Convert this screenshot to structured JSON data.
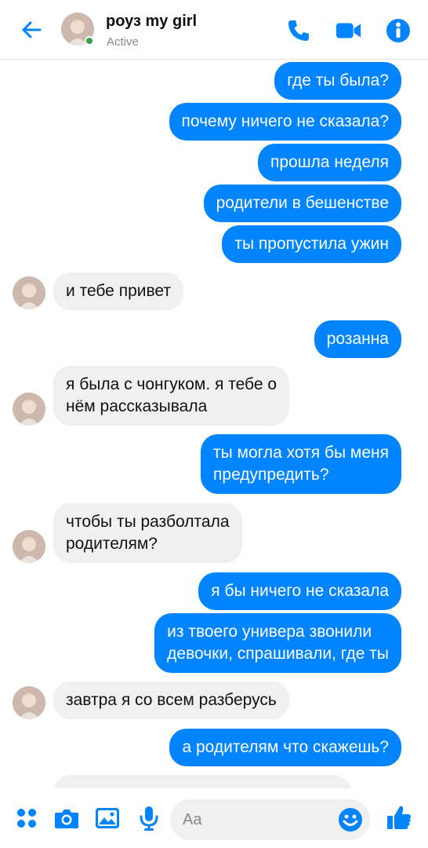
{
  "header": {
    "contact_name": "роуз my girl",
    "status": "Active"
  },
  "messages": [
    {
      "dir": "out",
      "text": "где ты была?"
    },
    {
      "dir": "out",
      "text": "почему ничего не сказала?"
    },
    {
      "dir": "out",
      "text": "прошла неделя"
    },
    {
      "dir": "out",
      "text": "родители в бешенстве"
    },
    {
      "dir": "out",
      "text": "ты пропустила ужин"
    },
    {
      "dir": "in",
      "text": "и тебе привет"
    },
    {
      "dir": "out",
      "text": "розанна"
    },
    {
      "dir": "in",
      "text": "я была с чонгуком. я тебе о\nнём рассказывала"
    },
    {
      "dir": "out",
      "text": "ты могла хотя бы меня\nпредупредить?"
    },
    {
      "dir": "in",
      "text": "чтобы ты разболтала\nродителям?"
    },
    {
      "dir": "out",
      "text": "я бы ничего не сказала"
    },
    {
      "dir": "out",
      "text": "из твоего универа звонили\nдевочки, спрашивали, где ты"
    },
    {
      "dir": "in",
      "text": "завтра я со всем разберусь"
    },
    {
      "dir": "out",
      "text": "а родителям что скажешь?"
    }
  ],
  "composer": {
    "placeholder": "Aa"
  },
  "colors": {
    "accent": "#0084ff",
    "incoming_bubble": "#f1f0f0",
    "online": "#31a24c"
  },
  "icons": [
    "back-arrow-icon",
    "phone-icon",
    "video-camera-icon",
    "info-icon",
    "apps-grid-icon",
    "camera-icon",
    "image-icon",
    "microphone-icon",
    "emoji-icon",
    "thumbs-up-icon"
  ]
}
